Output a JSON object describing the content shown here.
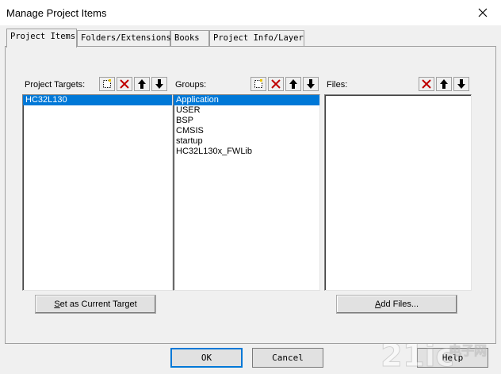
{
  "window": {
    "title": "Manage Project Items"
  },
  "tabs": [
    {
      "label": "Project Items",
      "active": true
    },
    {
      "label": "Folders/Extensions",
      "active": false
    },
    {
      "label": "Books",
      "active": false
    },
    {
      "label": "Project Info/Layer",
      "active": false
    }
  ],
  "targets": {
    "header": "Project Targets:",
    "items": [
      {
        "label": "HC32L130",
        "selected": true
      }
    ],
    "set_current_button": {
      "prefix": "S",
      "rest": "et as Current Target"
    }
  },
  "groups": {
    "header": "Groups:",
    "items": [
      {
        "label": "Application",
        "selected": true
      },
      {
        "label": "USER",
        "selected": false
      },
      {
        "label": "BSP",
        "selected": false
      },
      {
        "label": "CMSIS",
        "selected": false
      },
      {
        "label": "startup",
        "selected": false
      },
      {
        "label": "HC32L130x_FWLib",
        "selected": false
      }
    ]
  },
  "files": {
    "header": "Files:",
    "items": [],
    "add_files_button": {
      "prefix": "A",
      "rest": "dd Files..."
    }
  },
  "buttons": {
    "ok": "OK",
    "cancel": "Cancel",
    "help": "Help"
  },
  "watermark": {
    "text": "21ic电子网"
  },
  "colors": {
    "selection": "#0078d7",
    "delete_red": "#c00000"
  }
}
